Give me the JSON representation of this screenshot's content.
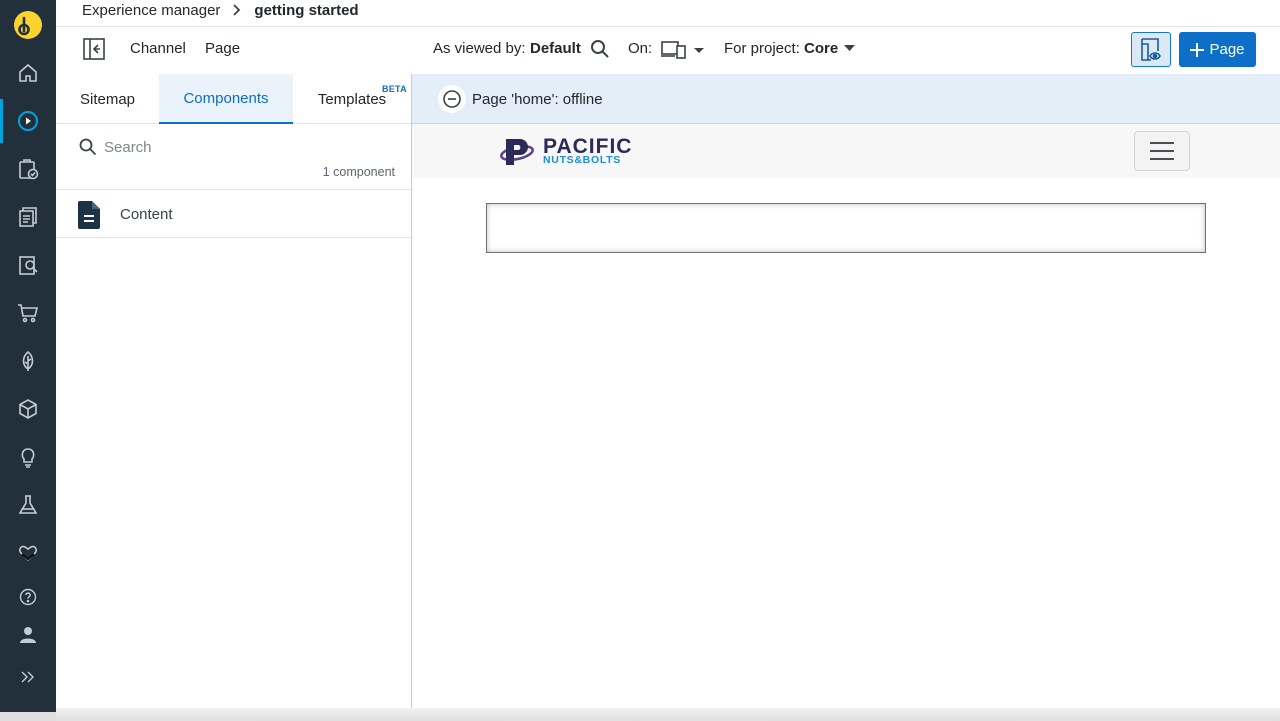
{
  "breadcrumb": {
    "section": "Experience manager",
    "current": "getting started"
  },
  "toolbar": {
    "channel_label": "Channel",
    "page_label": "Page",
    "viewed_by_label": "As viewed by:",
    "viewed_by_value": "Default",
    "on_label": "On:",
    "project_label": "For project:",
    "project_value": "Core",
    "add_page_label": "Page"
  },
  "left_panel": {
    "tabs": [
      {
        "label": "Sitemap"
      },
      {
        "label": "Components"
      },
      {
        "label": "Templates",
        "badge": "BETA"
      }
    ],
    "active_tab": "Components",
    "search_placeholder": "Search",
    "component_count": "1 component",
    "components": [
      {
        "label": "Content",
        "icon": "document-icon"
      }
    ]
  },
  "status": {
    "text": "Page 'home': offline",
    "icon": "offline-minus-icon"
  },
  "preview": {
    "logo_line1": "PACIFIC",
    "logo_line2": "NUTS&BOLTS"
  },
  "nav_rail": {
    "items": [
      "home-icon",
      "experience-manager-icon",
      "projects-icon",
      "content-icon",
      "document-search-icon",
      "commerce-cart-icon",
      "leaf-icon",
      "cube-icon",
      "lightbulb-icon",
      "flask-icon",
      "heart-icon",
      "help-icon",
      "user-icon",
      "expand-icon"
    ],
    "active": "experience-manager-icon"
  },
  "colors": {
    "accent": "#0d6fc8",
    "rail": "#22303c",
    "logo": "#fcd22e",
    "active_indicator": "#00a3e0"
  }
}
